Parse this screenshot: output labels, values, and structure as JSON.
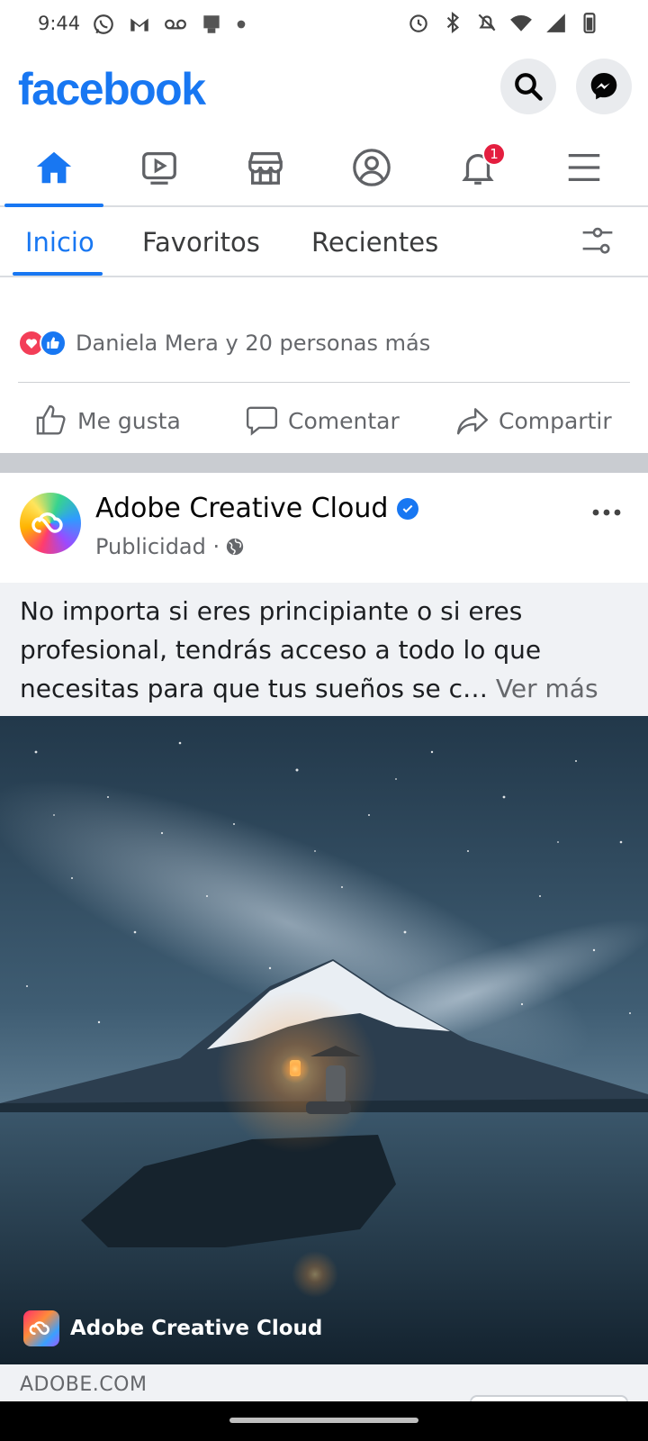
{
  "status_bar": {
    "time": "9:44",
    "left_icons": [
      "whatsapp-icon",
      "gmail-icon",
      "voicemail-icon",
      "store-icon",
      "dot-icon"
    ],
    "right_icons": [
      "alarm-icon",
      "bluetooth-icon",
      "mute-icon",
      "wifi-icon",
      "signal-icon",
      "battery-icon"
    ]
  },
  "header": {
    "logo": "facebook",
    "brand_color": "#1877f2",
    "buttons": [
      "search-icon",
      "messenger-icon"
    ]
  },
  "nav": {
    "items": [
      {
        "name": "home",
        "active": true
      },
      {
        "name": "watch"
      },
      {
        "name": "marketplace"
      },
      {
        "name": "profile"
      },
      {
        "name": "notifications",
        "badge": "1"
      },
      {
        "name": "menu"
      }
    ]
  },
  "feed_tabs": {
    "tabs": [
      {
        "label": "Inicio",
        "active": true
      },
      {
        "label": "Favoritos"
      },
      {
        "label": "Recientes"
      }
    ]
  },
  "prev_post": {
    "reactions_text": "Daniela Mera y 20 personas más",
    "actions": {
      "like": "Me gusta",
      "comment": "Comentar",
      "share": "Compartir"
    }
  },
  "ad_post": {
    "page_name": "Adobe Creative Cloud",
    "meta": "Publicidad ·",
    "text": "No importa si eres principiante o si eres profesional, tendrás acceso a todo lo que necesitas para que tus sueños se c…",
    "see_more": "Ver más",
    "image_brand": "Adobe Creative Cloud",
    "domain": "ADOBE.COM"
  }
}
